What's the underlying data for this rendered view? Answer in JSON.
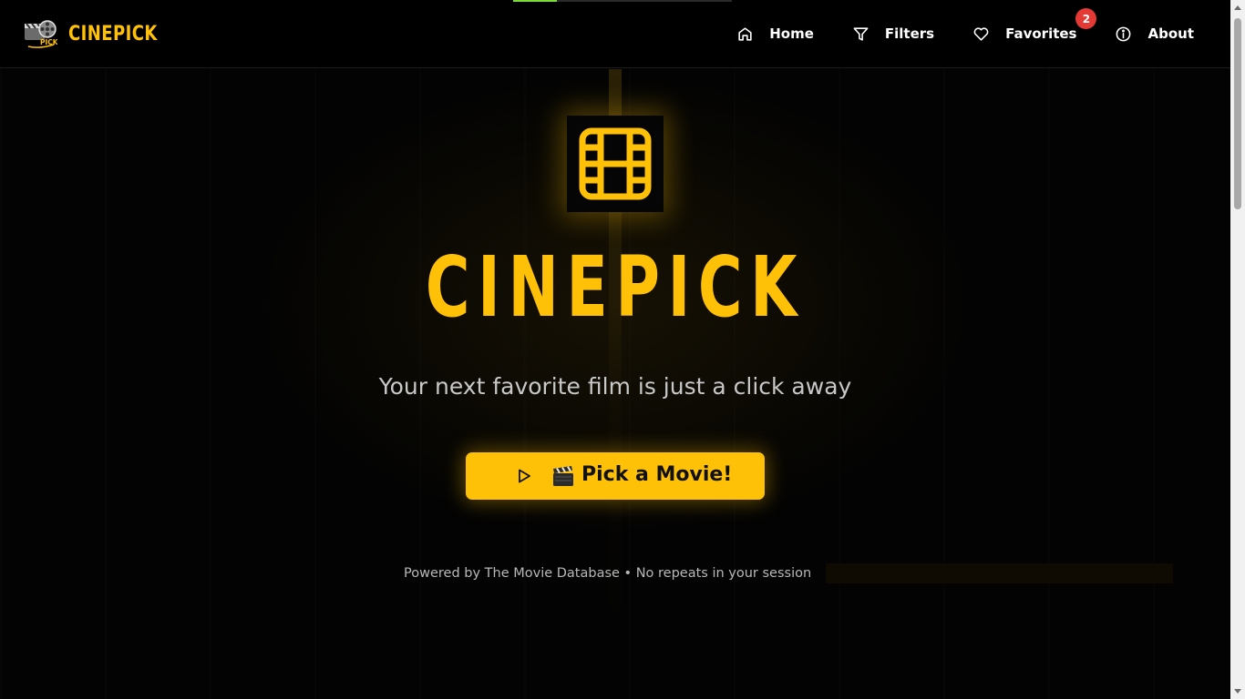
{
  "header": {
    "brand_name": "CINEPICK",
    "logo_text": "PICK",
    "nav": [
      {
        "label": "Home",
        "icon": "home-icon"
      },
      {
        "label": "Filters",
        "icon": "filter-icon"
      },
      {
        "label": "Favorites",
        "icon": "heart-icon",
        "badge": "2"
      },
      {
        "label": "About",
        "icon": "info-icon"
      }
    ]
  },
  "progress": {
    "fraction": 0.2,
    "color": "#7dd83a"
  },
  "hero": {
    "icon": "film-icon",
    "title": "CINEPICK",
    "tagline": "Your next favorite film is just a click away",
    "cta_label": "Pick a Movie!",
    "cta_icons": [
      "play-icon",
      "clapperboard-icon"
    ]
  },
  "footer": {
    "text": "Powered by The Movie Database • No repeats in your session"
  },
  "colors": {
    "accent": "#ffc107",
    "background": "#000000",
    "badge": "#e53935",
    "text_muted": "#c8c8c8"
  }
}
